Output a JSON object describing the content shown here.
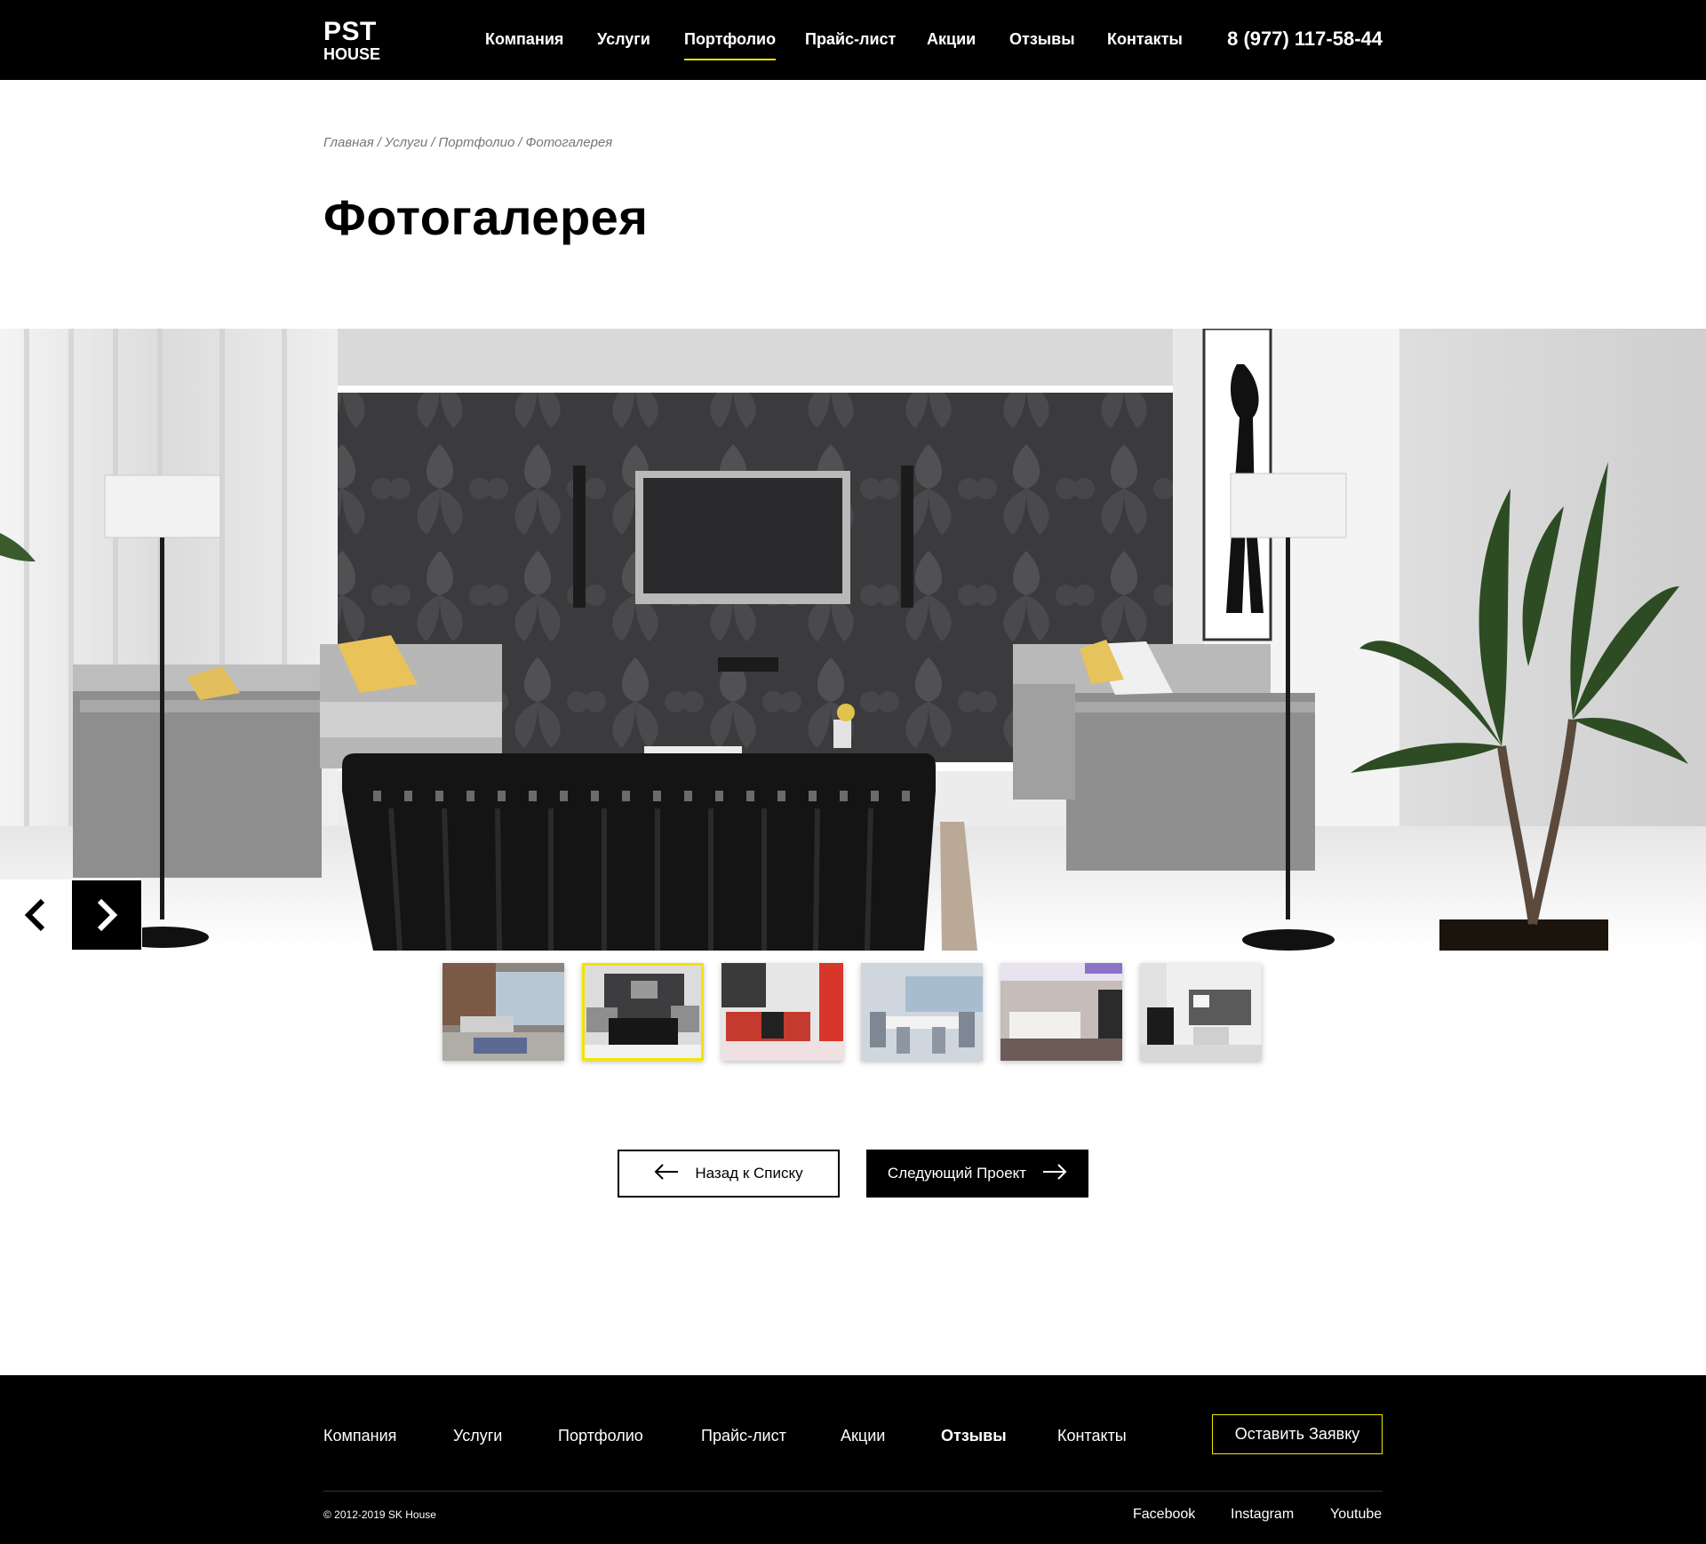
{
  "brand": {
    "line1": "PST",
    "line2": "HOUSE"
  },
  "nav": {
    "items": [
      {
        "label": "Компания"
      },
      {
        "label": "Услуги"
      },
      {
        "label": "Портфолио"
      },
      {
        "label": "Прайс-лист"
      },
      {
        "label": "Акции"
      },
      {
        "label": "Отзывы"
      },
      {
        "label": "Контакты"
      }
    ],
    "active": "Портфолио",
    "phone": "8 (977) 117-58-44"
  },
  "breadcrumb": {
    "items": [
      "Главная",
      "Услуги",
      "Портфолио",
      "Фотогалерея"
    ],
    "separator": "/"
  },
  "page": {
    "title": "Фотогалерея"
  },
  "gallery": {
    "prev_icon": "chevron-left-icon",
    "next_icon": "chevron-right-icon",
    "thumbnail_count": 6,
    "active_thumbnail": 2
  },
  "actions": {
    "back_label": "Назад к Списку",
    "next_label": "Следующий Проект"
  },
  "footer": {
    "nav": [
      "Компания",
      "Услуги",
      "Портфолио",
      "Прайс-лист",
      "Акции",
      "Отзывы",
      "Контакты"
    ],
    "cta_label": "Оставить Заявку",
    "copyright": "©  2012-2019  SK House",
    "social": [
      "Facebook",
      "Instagram",
      "Youtube"
    ]
  },
  "colors": {
    "accent": "#f2e400",
    "header_bg": "#000000",
    "footer_bg": "#000000"
  }
}
